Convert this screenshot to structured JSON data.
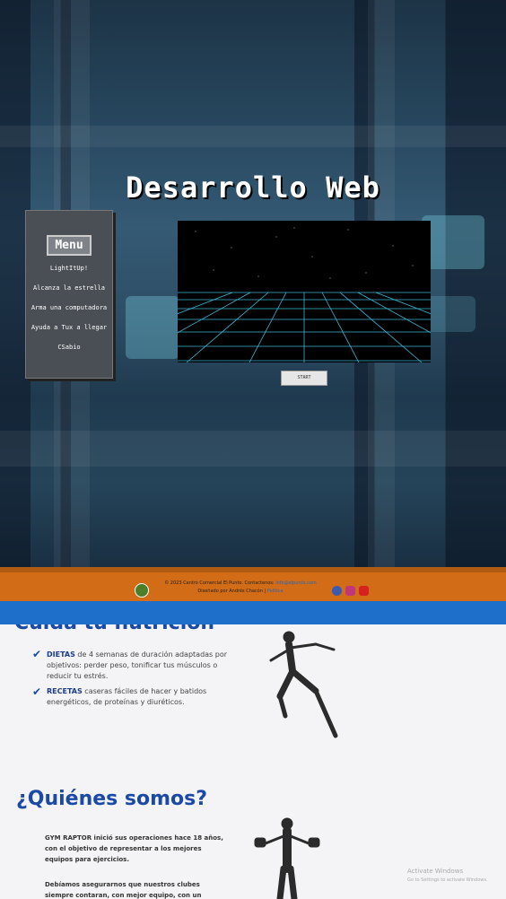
{
  "hero": {
    "title": "Desarrollo Web",
    "menu": {
      "title": "Menu",
      "items": [
        "LightItUp!",
        "Alcanza la estrella",
        "Arma una computadora",
        "Ayuda a Tux a llegar",
        "CSabio"
      ]
    },
    "start_label": "START"
  },
  "footer": {
    "line1": "© 2023 Centro Comercial El Punto. Contactenos:",
    "email": "info@elpunto.com",
    "line2": "Diseñado por Andrés Chacón |",
    "link2": "Política"
  },
  "content": {
    "nutrition_title": "Cuida tu nutrición",
    "bullets": [
      {
        "bold": "DIETAS",
        "text": " de 4 semanas de duración adaptadas por objetivos: perder peso, tonificar tus músculos o reducir tu estrés."
      },
      {
        "bold": "RECETAS",
        "text": " caseras fáciles de hacer y batidos energéticos, de proteínas y diuréticos."
      }
    ],
    "about_title": "¿Quiénes somos?",
    "about_p1": "GYM RAPTOR inició sus operaciones hace 18 años, con el objetivo de representar a los mejores equipos para ejercicios.",
    "about_p2": "Debíamos asegurarnos que nuestros clubes siempre contaran, con mejor equipo, con un",
    "watermark_1": "Activate Windows",
    "watermark_2": "Go to Settings to activate Windows."
  },
  "colors": {
    "footer": "#d26c17",
    "bluebar": "#1d6fc9",
    "heading": "#1a4aa6"
  }
}
